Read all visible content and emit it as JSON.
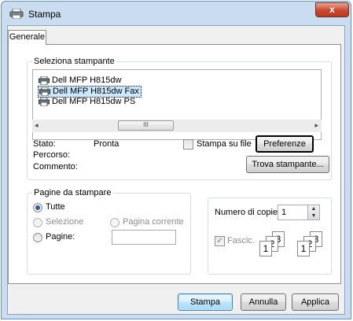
{
  "window": {
    "title": "Stampa",
    "close_glyph": "x"
  },
  "tabs": [
    {
      "label": "Generale"
    }
  ],
  "select_printer": {
    "legend": "Seleziona stampante",
    "printers": [
      {
        "name": "Dell MFP H815dw",
        "selected": false
      },
      {
        "name": "Dell MFP H815dw Fax",
        "selected": true
      },
      {
        "name": "Dell MFP H815dw PS",
        "selected": false
      }
    ],
    "scroll_left": "◂",
    "scroll_right": "▸",
    "scroll_thumb": "III",
    "status_label": "Stato:",
    "status_value": "Pronta",
    "location_label": "Percorso:",
    "comment_label": "Commento:",
    "print_to_file_label": "Stampa su file",
    "print_to_file_checked": false,
    "preferences_button": "Preferenze",
    "find_printer_button": "Trova stampante..."
  },
  "page_range": {
    "legend": "Pagine da stampare",
    "all_label": "Tutte",
    "selection_label": "Selezione",
    "current_page_label": "Pagina corrente",
    "pages_label": "Pagine:",
    "pages_value": ""
  },
  "copies": {
    "number_label": "Numero di copie:",
    "number_value": "1",
    "spin_up": "▲",
    "spin_down": "▼",
    "collate_label": "Fascic.",
    "collate_checked": true,
    "collate_check_glyph": "✓",
    "collated_icon_digits": [
      "1",
      "2",
      "3"
    ],
    "uncollated_icon_digits": [
      "1",
      "2",
      "3"
    ]
  },
  "buttons": {
    "print": "Stampa",
    "cancel": "Annulla",
    "apply": "Applica"
  }
}
